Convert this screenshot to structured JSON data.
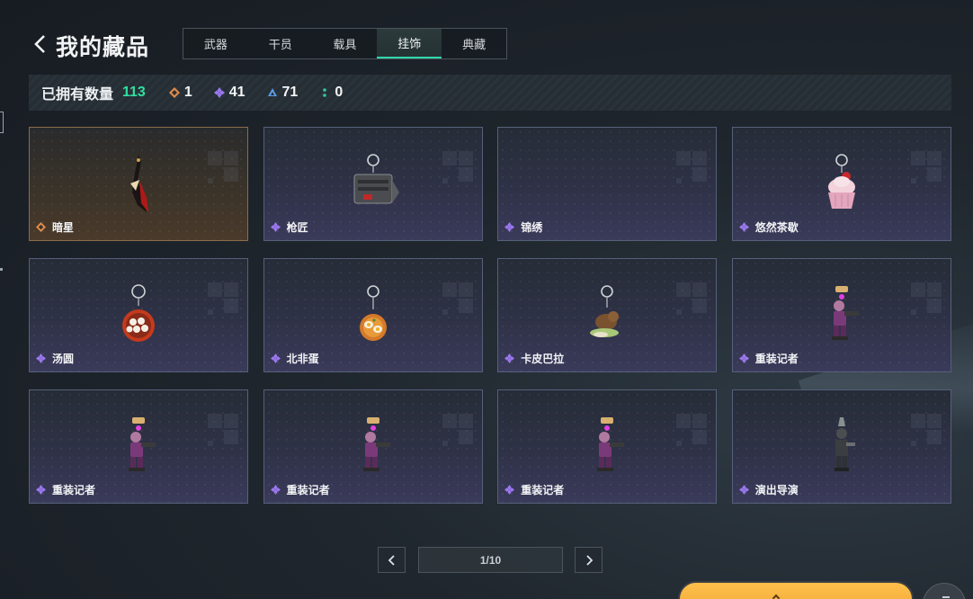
{
  "header": {
    "title": "我的藏品",
    "tabs": [
      {
        "label": "武器"
      },
      {
        "label": "干员"
      },
      {
        "label": "载具"
      },
      {
        "label": "挂饰",
        "active": true
      },
      {
        "label": "典藏"
      }
    ]
  },
  "stats": {
    "label": "已拥有数量",
    "total": "113",
    "counts": [
      {
        "icon": "gold-rarity-diamond-icon",
        "color": "#e08a4a",
        "value": "1"
      },
      {
        "icon": "purple-rarity-diamond-icon",
        "color": "#9b78f0",
        "value": "41"
      },
      {
        "icon": "blue-rarity-triangle-icon",
        "color": "#5a9be8",
        "value": "71"
      },
      {
        "icon": "green-rarity-dots-icon",
        "color": "#33c79a",
        "value": "0"
      }
    ]
  },
  "items": [
    {
      "name": "暗星",
      "rarity": "gold",
      "art": "dark-star-charm-icon"
    },
    {
      "name": "枪匠",
      "rarity": "purple",
      "art": "gunsmith-charm-icon"
    },
    {
      "name": "锦绣",
      "rarity": "purple",
      "art": "empty"
    },
    {
      "name": "悠然茶歇",
      "rarity": "purple",
      "art": "cupcake-charm-icon"
    },
    {
      "name": "汤圆",
      "rarity": "purple",
      "art": "tangyuan-bowl-charm-icon"
    },
    {
      "name": "北非蛋",
      "rarity": "purple",
      "art": "shakshuka-pan-charm-icon"
    },
    {
      "name": "卡皮巴拉",
      "rarity": "purple",
      "art": "capybara-charm-icon"
    },
    {
      "name": "重装记者",
      "rarity": "purple",
      "art": "heavy-reporter-figure-icon"
    },
    {
      "name": "重装记者",
      "rarity": "purple",
      "art": "heavy-reporter-figure-icon"
    },
    {
      "name": "重装记者",
      "rarity": "purple",
      "art": "heavy-reporter-figure-icon"
    },
    {
      "name": "重装记者",
      "rarity": "purple",
      "art": "heavy-reporter-figure-icon"
    },
    {
      "name": "演出导演",
      "rarity": "purple",
      "art": "show-director-figure-icon"
    }
  ],
  "pagination": {
    "indicator": "1/10"
  },
  "colors": {
    "accent": "#2fd8a8",
    "total": "#2fe0a0",
    "gold": "#e08a4a",
    "purple": "#9b78f0"
  }
}
